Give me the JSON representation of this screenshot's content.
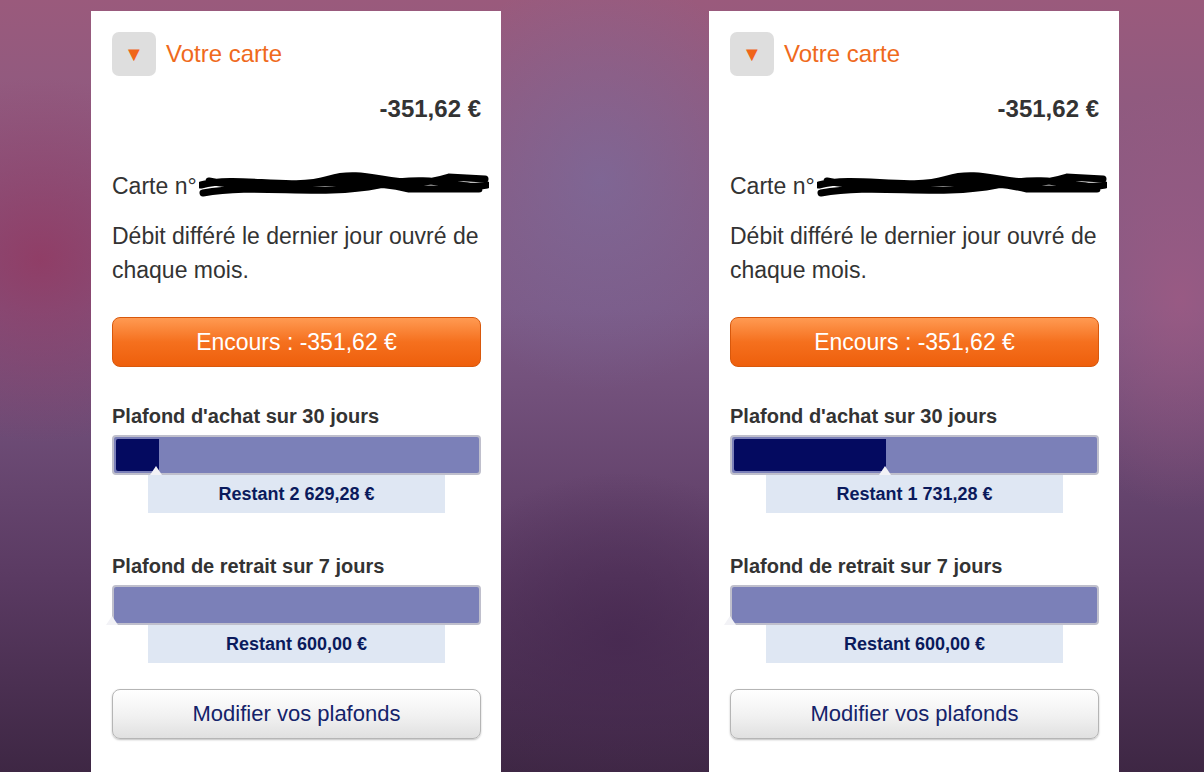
{
  "cards": [
    {
      "toggle": "▼",
      "title": "Votre carte",
      "balance": "-351,62 €",
      "card_label": "Carte n°",
      "redacted": true,
      "debit_note": "Débit différé le dernier jour ouvré de chaque mois.",
      "encours": "Encours : -351,62 €",
      "limits": [
        {
          "title": "Plafond d'achat sur 30 jours",
          "level": 0.12,
          "remaining": "Restant 2 629,28 €"
        },
        {
          "title": "Plafond de retrait sur 7 jours",
          "level": 0,
          "remaining": "Restant 600,00 €"
        }
      ],
      "button": "Modifier vos plafonds"
    },
    {
      "toggle": "▼",
      "title": "Votre carte",
      "balance": "-351,62 €",
      "card_label": "Carte n°",
      "redacted": true,
      "debit_note": "Débit différé le dernier jour ouvré de chaque mois.",
      "encours": "Encours : -351,62 €",
      "limits": [
        {
          "title": "Plafond d'achat sur 30 jours",
          "level": 0.42,
          "remaining": "Restant 1 731,28 €"
        },
        {
          "title": "Plafond de retrait sur 7 jours",
          "level": 0,
          "remaining": "Restant 600,00 €"
        }
      ],
      "button": "Modifier vos plafonds"
    }
  ]
}
